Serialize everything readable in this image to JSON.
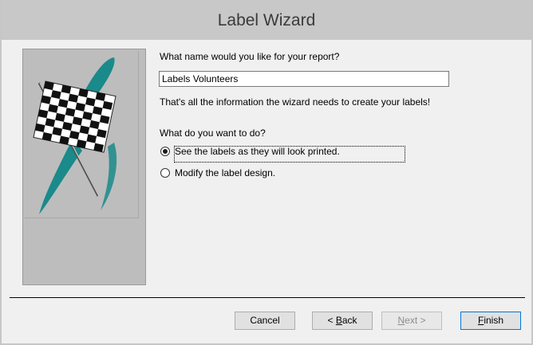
{
  "window": {
    "title": "Label Wizard"
  },
  "form": {
    "report_name_prompt": "What name would you like for your report?",
    "report_name_value": "Labels Volunteers",
    "info_text": "That's all the information the wizard needs to create your labels!",
    "action_prompt": "What do you want to do?",
    "options": [
      {
        "label": "See the labels as they will look printed.",
        "selected": true
      },
      {
        "label": "Modify the label design.",
        "selected": false
      }
    ]
  },
  "buttons": {
    "cancel": "Cancel",
    "back_prefix": "< ",
    "back_mnemonic": "B",
    "back_rest": "ack",
    "next_prefix": "",
    "next_mnemonic": "N",
    "next_rest": "ext >",
    "finish_mnemonic": "F",
    "finish_rest": "inish"
  },
  "colors": {
    "titlebar": "#c8c8c8",
    "body": "#f0f0f0",
    "side_panel": "#bdbdbd",
    "teal_brush": "#1a8a8a",
    "finish_border": "#0078d7"
  },
  "icons": {
    "flag": "checkered-flag-icon"
  }
}
